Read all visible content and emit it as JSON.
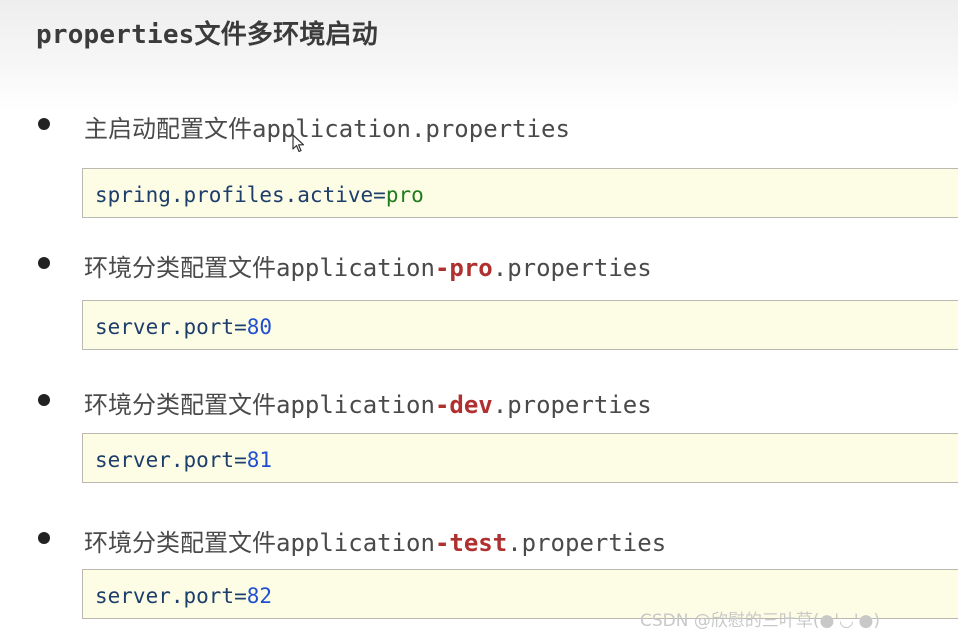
{
  "title": "properties文件多环境启动",
  "items": [
    {
      "bullet_prefix": "主启动配置文件application",
      "bullet_highlight": "",
      "bullet_suffix": ".properties",
      "code_key": "spring.profiles.active",
      "code_eq": "=",
      "code_value": "pro"
    },
    {
      "bullet_prefix": "环境分类配置文件application",
      "bullet_highlight": "-pro",
      "bullet_suffix": ".properties",
      "code_key": "server.port",
      "code_eq": "=",
      "code_value": "80"
    },
    {
      "bullet_prefix": "环境分类配置文件application",
      "bullet_highlight": "-dev",
      "bullet_suffix": ".properties",
      "code_key": "server.port",
      "code_eq": "=",
      "code_value": "81"
    },
    {
      "bullet_prefix": "环境分类配置文件application",
      "bullet_highlight": "-test",
      "bullet_suffix": ".properties",
      "code_key": "server.port",
      "code_eq": "=",
      "code_value": "82"
    }
  ],
  "watermark": "CSDN @欣慰的三叶草(●'◡'●)",
  "colors": {
    "highlight": "#b03030",
    "code_key": "#1d3d6b",
    "code_number": "#1f4fd0",
    "code_string": "#1d7a1d",
    "code_background": "#fdfde6"
  },
  "icons": {
    "cursor": "mouse-pointer-icon"
  }
}
